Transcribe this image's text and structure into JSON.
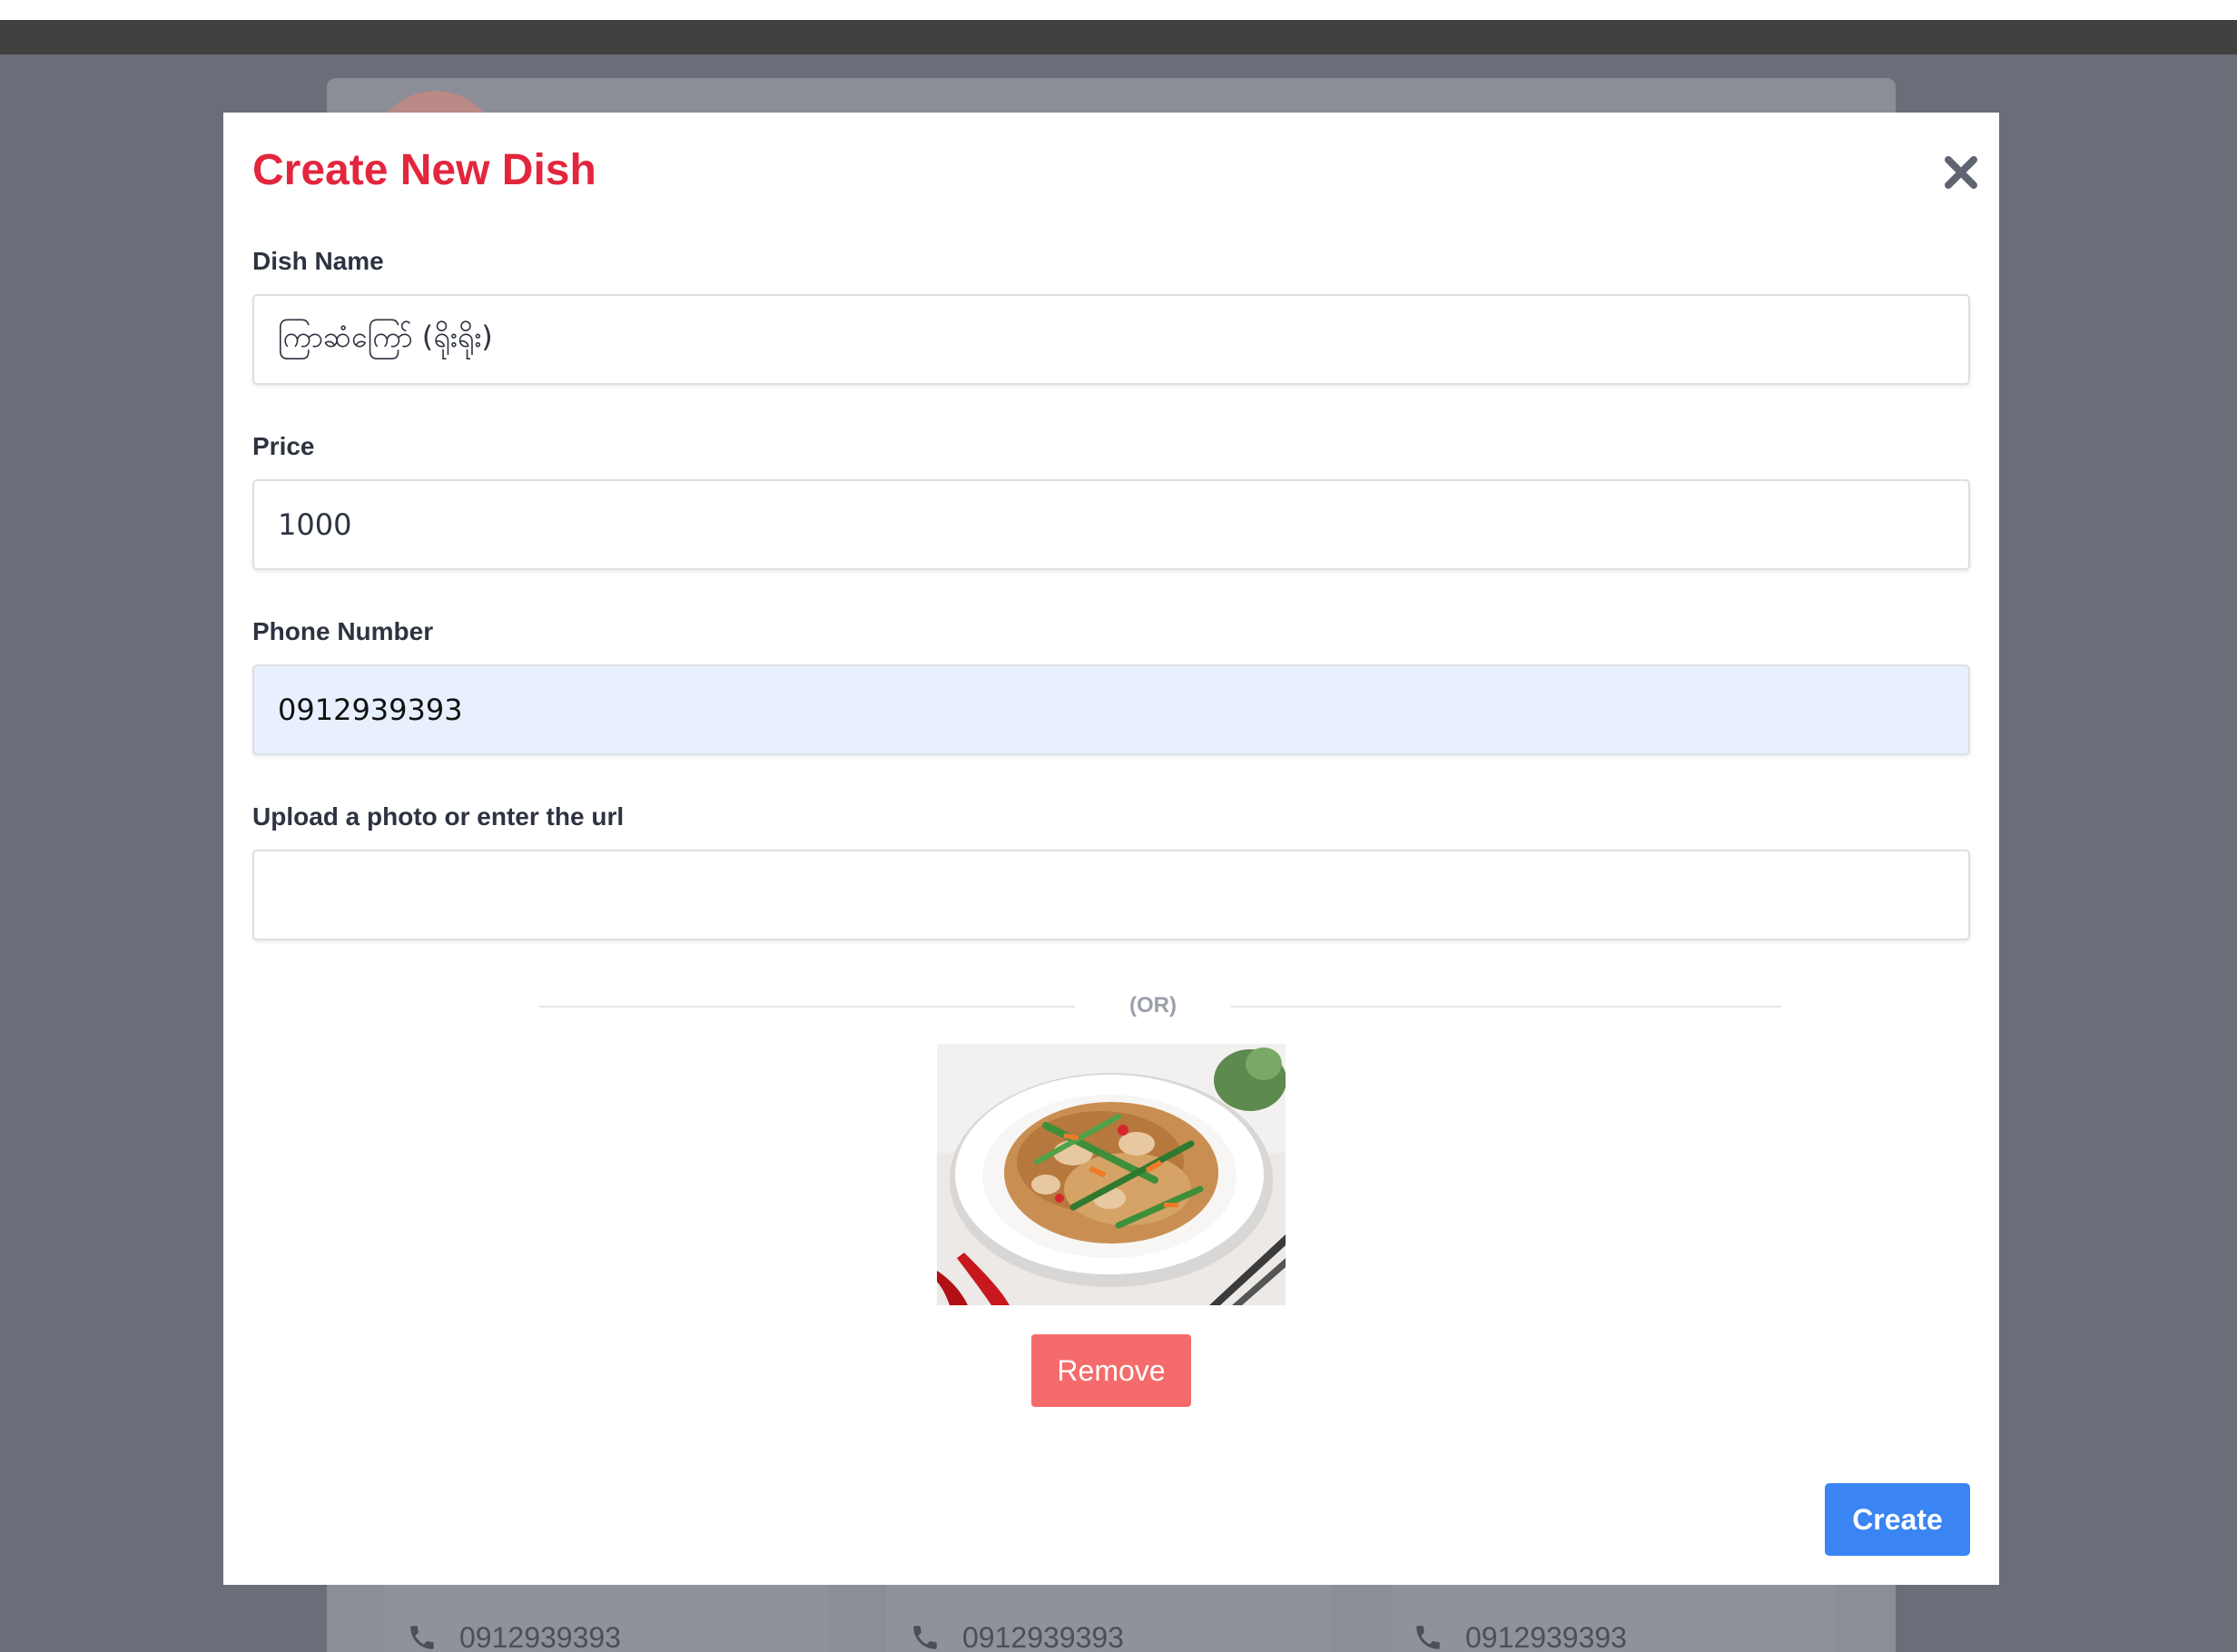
{
  "modal": {
    "title": "Create New Dish",
    "close_icon": "close-icon"
  },
  "form": {
    "dish_name": {
      "label": "Dish Name",
      "value": "ကြာဆံကြော် (ရိုးရိုး)"
    },
    "price": {
      "label": "Price",
      "value": "1000"
    },
    "phone": {
      "label": "Phone Number",
      "value": "0912939393"
    },
    "photo": {
      "label": "Upload a photo or enter the url",
      "value": ""
    },
    "or_text": "(OR)",
    "preview_image": "stir-fried-noodles-photo",
    "remove_label": "Remove",
    "create_label": "Create"
  },
  "background": {
    "cards": [
      {
        "phone": "0912939393",
        "icon": "phone-icon"
      },
      {
        "phone": "0912939393",
        "icon": "phone-icon"
      },
      {
        "phone": "0912939393",
        "icon": "phone-icon"
      }
    ]
  },
  "colors": {
    "title": "#e3263d",
    "create_button": "#3a84f3",
    "remove_button": "#f56b6b",
    "overlay": "#6b6e78",
    "autofill_field": "#e8f0fe"
  }
}
